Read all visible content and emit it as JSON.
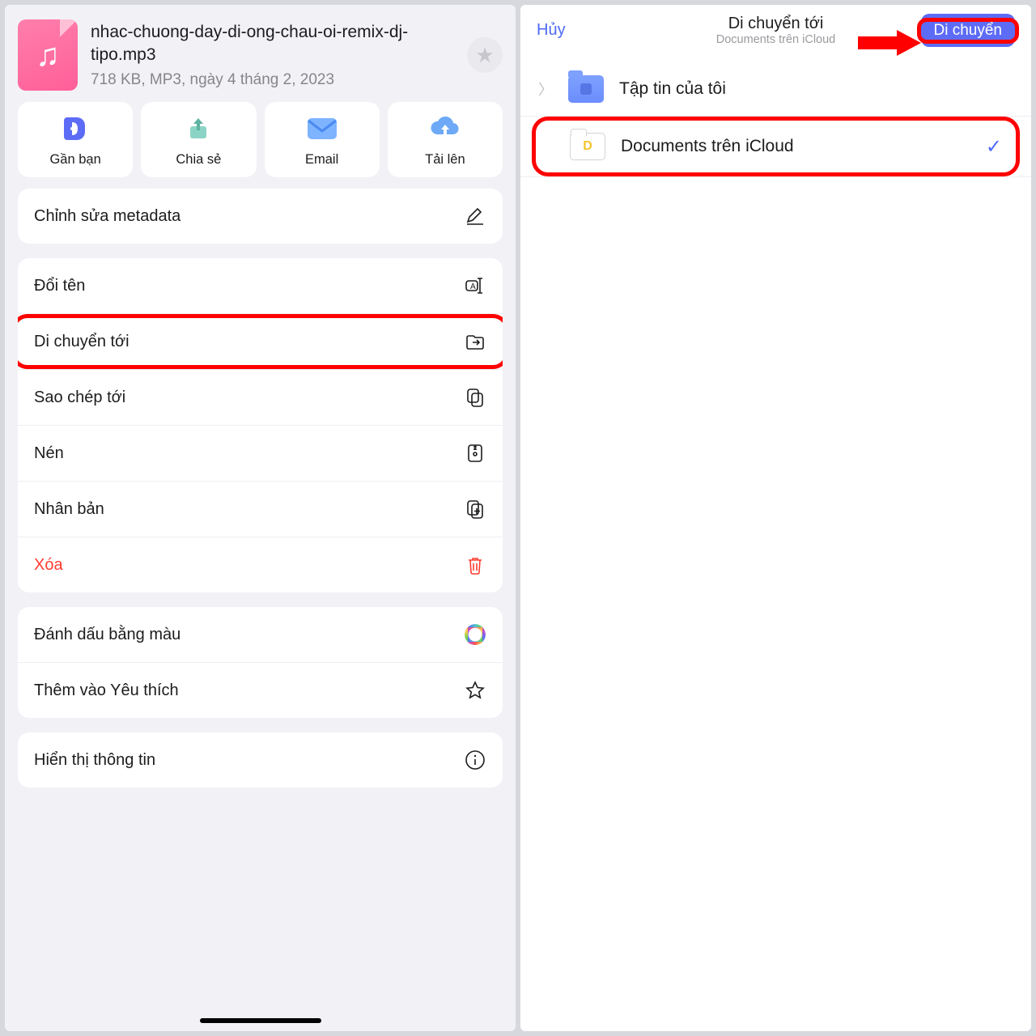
{
  "left": {
    "file": {
      "name": "nhac-chuong-day-di-ong-chau-oi-remix-dj-tipo.mp3",
      "meta": "718 KB, MP3, ngày 4 tháng 2, 2023"
    },
    "actions": [
      {
        "label": "Gần bạn",
        "icon": "nearby-icon"
      },
      {
        "label": "Chia sẻ",
        "icon": "share-icon"
      },
      {
        "label": "Email",
        "icon": "email-icon"
      },
      {
        "label": "Tải lên",
        "icon": "upload-icon"
      }
    ],
    "section_meta": {
      "label": "Chỉnh sửa metadata"
    },
    "file_ops": [
      {
        "label": "Đổi tên",
        "icon": "rename-icon"
      },
      {
        "label": "Di chuyển tới",
        "icon": "move-icon",
        "highlight": true
      },
      {
        "label": "Sao chép tới",
        "icon": "copy-icon"
      },
      {
        "label": "Nén",
        "icon": "zip-icon"
      },
      {
        "label": "Nhân bản",
        "icon": "duplicate-icon"
      },
      {
        "label": "Xóa",
        "icon": "trash-icon",
        "danger": true
      }
    ],
    "misc": [
      {
        "label": "Đánh dấu bằng màu",
        "icon": "color-icon"
      },
      {
        "label": "Thêm vào Yêu thích",
        "icon": "star-icon"
      }
    ],
    "info": {
      "label": "Hiển thị thông tin"
    }
  },
  "right": {
    "cancel": "Hủy",
    "title": "Di chuyển tới",
    "subtitle": "Documents trên iCloud",
    "move_button": "Di chuyển",
    "folders": [
      {
        "label": "Tập tin của tôi",
        "type": "blue"
      },
      {
        "label": "Documents trên iCloud",
        "type": "white",
        "selected": true,
        "highlight": true
      }
    ]
  }
}
